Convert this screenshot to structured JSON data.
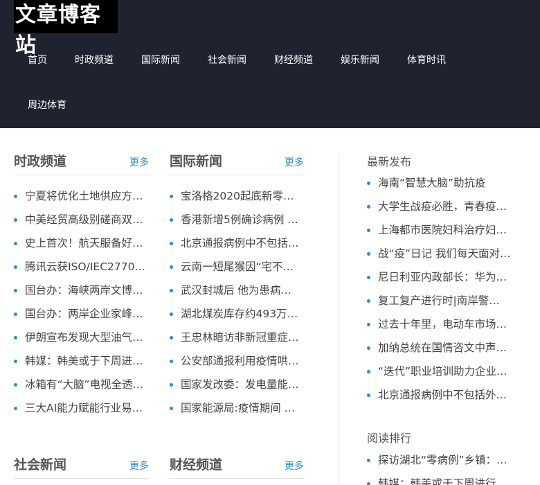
{
  "site": {
    "logo_text": "文章博客站"
  },
  "nav": {
    "items": [
      "首页",
      "时政频道",
      "国际新闻",
      "社会新闻",
      "财经频道",
      "娱乐新闻",
      "体育时讯",
      "周边体育"
    ]
  },
  "sections": {
    "politics": {
      "title": "时政频道",
      "more": "更多",
      "items": [
        "宁夏将优化土地供应方…",
        "中美经贸高级别磋商双…",
        "史上首次！航天服备好…",
        "腾讯云获ISO/IEC2770…",
        "国台办：海峡两岸文博…",
        "国台办：两岸企业家峰…",
        "伊朗宣布发现大型油气…",
        "韩媒：韩美或于下周进…",
        "冰箱有“大脑”电视全透…",
        "三大AI能力赋能行业易…"
      ]
    },
    "international": {
      "title": "国际新闻",
      "more": "更多",
      "items": [
        "宝洛格2020起底新零…",
        "香港新增5例确诊病例 …",
        "北京通报病例中不包括…",
        "云南一短尾猴因“宅不…",
        "武汉封城后 他为患病…",
        "湖北煤炭库存约493万…",
        "王忠林暗访非新冠重症…",
        "公安部通报利用疫情哄…",
        "国家发改委：发电量能…",
        "国家能源局:疫情期间 …"
      ]
    },
    "society": {
      "title": "社会新闻",
      "more": "更多"
    },
    "finance": {
      "title": "财经频道",
      "more": "更多"
    }
  },
  "sidebar": {
    "latest": {
      "title": "最新发布",
      "items": [
        "海南“智慧大脑”助抗疫",
        "大学生战疫必胜，青春疫…",
        "上海都市医院妇科治疗妇…",
        "战“疫”日记 我们每天面对…",
        "尼日利亚内政部长：华为…",
        "复工复产进行时|南岸警…",
        "过去十年里，电动车市场…",
        "加纳总统在国情咨文中声…",
        "“迭代”职业培训助力企业…",
        "北京通报病例中不包括外…"
      ]
    },
    "ranking": {
      "title": "阅读排行",
      "items": [
        "探访湖北“零病例”乡镇：…",
        "韩媒：韩美或于下周进行…"
      ]
    }
  },
  "colors": {
    "header_bg": "#1e232f",
    "accent": "#2a8ad4"
  }
}
